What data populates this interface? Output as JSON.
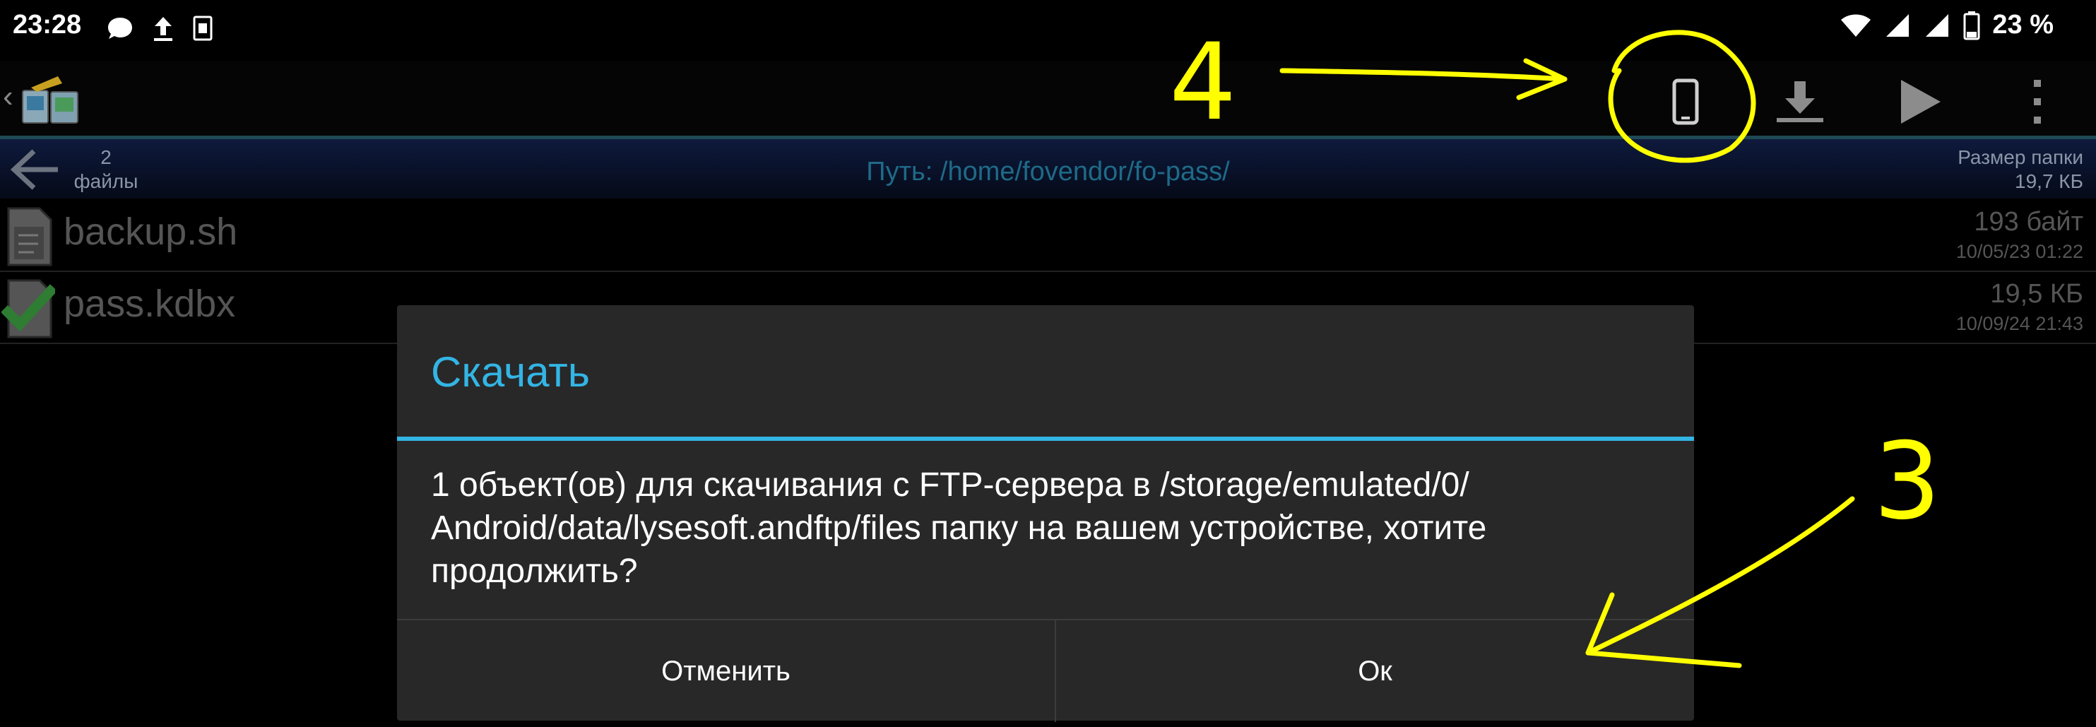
{
  "status_bar": {
    "time": "23:28",
    "battery_text": "23 %",
    "left_icons": [
      "message-icon",
      "upload-icon",
      "sim-icon"
    ],
    "right_icons": [
      "wifi-icon",
      "signal-icon",
      "signal-icon-2",
      "battery-icon"
    ]
  },
  "action_bar": {
    "actions": [
      "phone-icon",
      "download-icon",
      "play-icon",
      "overflow-menu-icon"
    ]
  },
  "path_bar": {
    "count_number": "2",
    "count_label": "файлы",
    "path": "Путь: /home/fovendor/fo-pass/",
    "folder_size_label": "Размер папки",
    "folder_size_value": "19,7 КБ"
  },
  "files": [
    {
      "name": "backup.sh",
      "size": "193 байт",
      "date": "10/05/23 01:22",
      "icon": "script-file-icon"
    },
    {
      "name": "pass.kdbx",
      "size": "19,5 КБ",
      "date": "10/09/24 21:43",
      "icon": "checked-file-icon"
    }
  ],
  "dialog": {
    "title": "Скачать",
    "message": "1 объект(ов) для скачивания с FTP-сервера в /storage/emulated/0/ Android/data/lysesoft.andftp/files папку на вашем устройстве, хотите продолжить?",
    "cancel_label": "Отменить",
    "ok_label": "Ок"
  },
  "annotations": {
    "label_4": "4",
    "label_3": "3",
    "color": "#ffff00"
  }
}
